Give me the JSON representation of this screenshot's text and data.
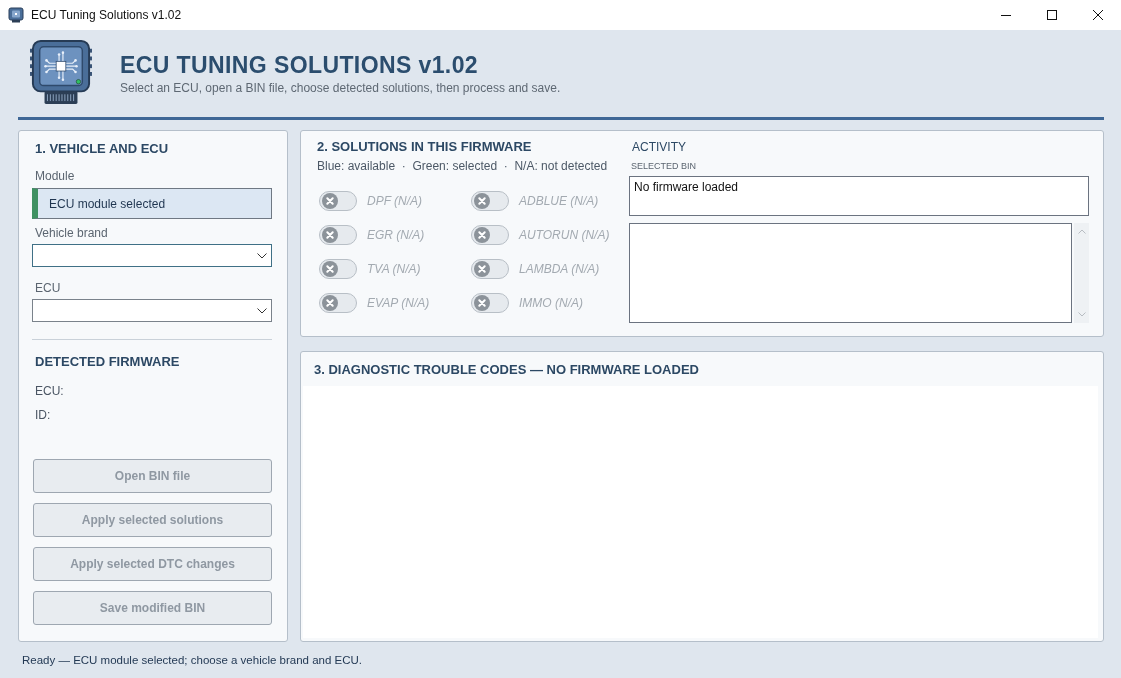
{
  "window": {
    "title": "ECU Tuning Solutions v1.02"
  },
  "header": {
    "title": "ECU TUNING SOLUTIONS v1.02",
    "subtitle": "Select an ECU, open a BIN file, choose detected solutions, then process and save."
  },
  "vehicle_panel": {
    "title": "1. VEHICLE AND ECU",
    "module": {
      "label": "Module",
      "value": "ECU module selected",
      "selected": true
    },
    "dropdowns": [
      {
        "label": "Vehicle brand",
        "focused": true
      },
      {
        "label": "ECU",
        "focused": false
      }
    ],
    "detected_firmware": {
      "title": "DETECTED FIRMWARE",
      "fields": [
        {
          "label": "ECU:"
        },
        {
          "label": "ID:"
        }
      ]
    },
    "buttons": [
      {
        "label": "Open BIN file",
        "disabled": true
      },
      {
        "label": "Apply selected solutions",
        "disabled": true
      },
      {
        "label": "Apply selected DTC changes",
        "disabled": true
      },
      {
        "label": "Save modified BIN",
        "disabled": true
      }
    ]
  },
  "firmware_panel": {
    "solutions": {
      "title": "2. SOLUTIONS IN THIS FIRMWARE",
      "legend": "Blue: available  ·  Green: selected  ·  N/A: not detected",
      "items": [
        {
          "label": "DPF (N/A)",
          "available": false
        },
        {
          "label": "ADBLUE (N/A)",
          "available": false
        },
        {
          "label": "EGR (N/A)",
          "available": false
        },
        {
          "label": "AUTORUN (N/A)",
          "available": false
        },
        {
          "label": "TVA (N/A)",
          "available": false
        },
        {
          "label": "LAMBDA (N/A)",
          "available": false
        },
        {
          "label": "EVAP (N/A)",
          "available": false
        },
        {
          "label": "IMMO (N/A)",
          "available": false
        }
      ]
    },
    "activity": {
      "title": "ACTIVITY",
      "selected_bin": {
        "label": "SELECTED BIN",
        "value": "No firmware loaded"
      }
    }
  },
  "dtc_panel": {
    "title": "3. DIAGNOSTIC TROUBLE CODES — NO FIRMWARE LOADED"
  },
  "status_bar": {
    "text": "Ready — ECU module selected; choose a vehicle brand and ECU."
  }
}
